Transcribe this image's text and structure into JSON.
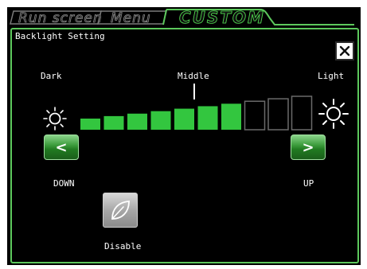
{
  "tabs": [
    {
      "label": "Run screen",
      "active": false
    },
    {
      "label": "Menu",
      "active": false
    },
    {
      "label": "CUSTOM",
      "active": true
    }
  ],
  "panel": {
    "title": "Backlight Setting",
    "close_icon": "close-icon"
  },
  "scale": {
    "dark_label": "Dark",
    "middle_label": "Middle",
    "light_label": "Light",
    "total_levels": 10,
    "level": 7
  },
  "buttons": {
    "down_symbol": "<",
    "down_label": "DOWN",
    "up_symbol": ">",
    "up_label": "UP",
    "disable_label": "Disable",
    "disable_icon": "leaf-icon"
  },
  "colors": {
    "accent": "#5cc85c",
    "bar_on": "#33c63f",
    "bar_off_border": "#6a6a6a"
  }
}
